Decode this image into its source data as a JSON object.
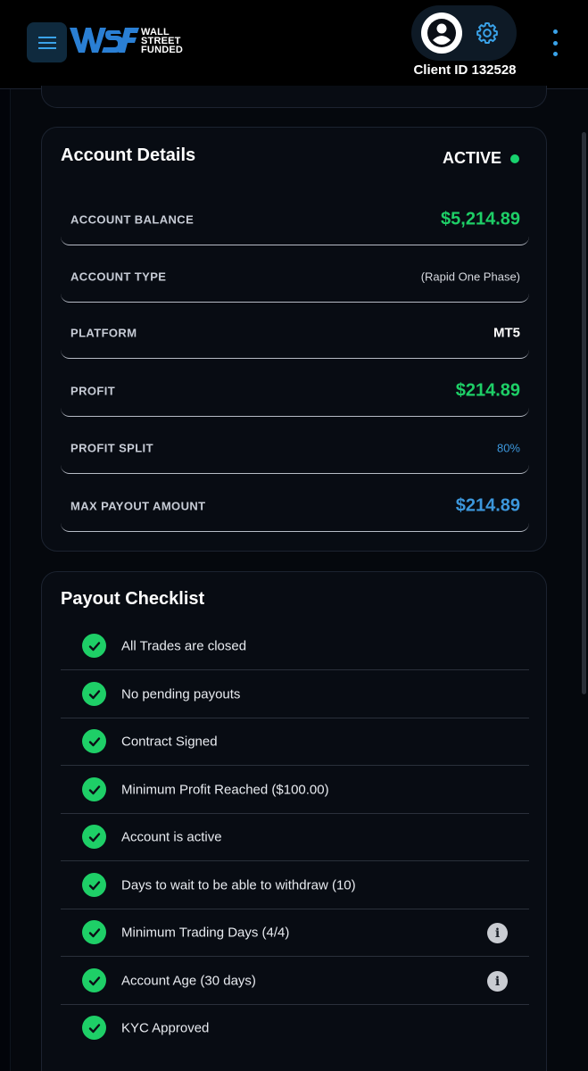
{
  "header": {
    "menu_icon": "hamburger-menu-icon",
    "logo": {
      "line1": "WALL",
      "line2": "STREET",
      "line3": "FUNDED",
      "mark": "WSF"
    },
    "avatar_icon": "user-avatar-icon",
    "settings_icon": "gear-icon",
    "client_id": "Client ID 132528",
    "more_icon": "kebab-menu-icon"
  },
  "account_details": {
    "title": "Account Details",
    "status": "ACTIVE",
    "status_color": "#18d26e",
    "rows": [
      {
        "label": "ACCOUNT BALANCE",
        "value": "$5,214.89"
      },
      {
        "label": "ACCOUNT TYPE",
        "value": "(Rapid One Phase)"
      },
      {
        "label": "PLATFORM",
        "value": "MT5"
      },
      {
        "label": "PROFIT",
        "value": "$214.89"
      },
      {
        "label": "PROFIT SPLIT",
        "value": "80%"
      },
      {
        "label": "MAX PAYOUT AMOUNT",
        "value": "$214.89"
      }
    ]
  },
  "payout_checklist": {
    "title": "Payout Checklist",
    "items": [
      {
        "text": "All Trades are closed",
        "info": false
      },
      {
        "text": "No pending payouts",
        "info": false
      },
      {
        "text": "Contract Signed",
        "info": false
      },
      {
        "text": "Minimum Profit Reached ($100.00)",
        "info": false
      },
      {
        "text": "Account is active",
        "info": false
      },
      {
        "text": "Days to wait to be able to withdraw (10)",
        "info": false
      },
      {
        "text": "Minimum Trading Days (4/4)",
        "info": true
      },
      {
        "text": "Account Age (30 days)",
        "info": true
      },
      {
        "text": "KYC Approved",
        "info": false
      }
    ]
  },
  "colors": {
    "accent_green": "#1ecf67",
    "accent_blue": "#3c97dc",
    "background": "#05080d"
  }
}
